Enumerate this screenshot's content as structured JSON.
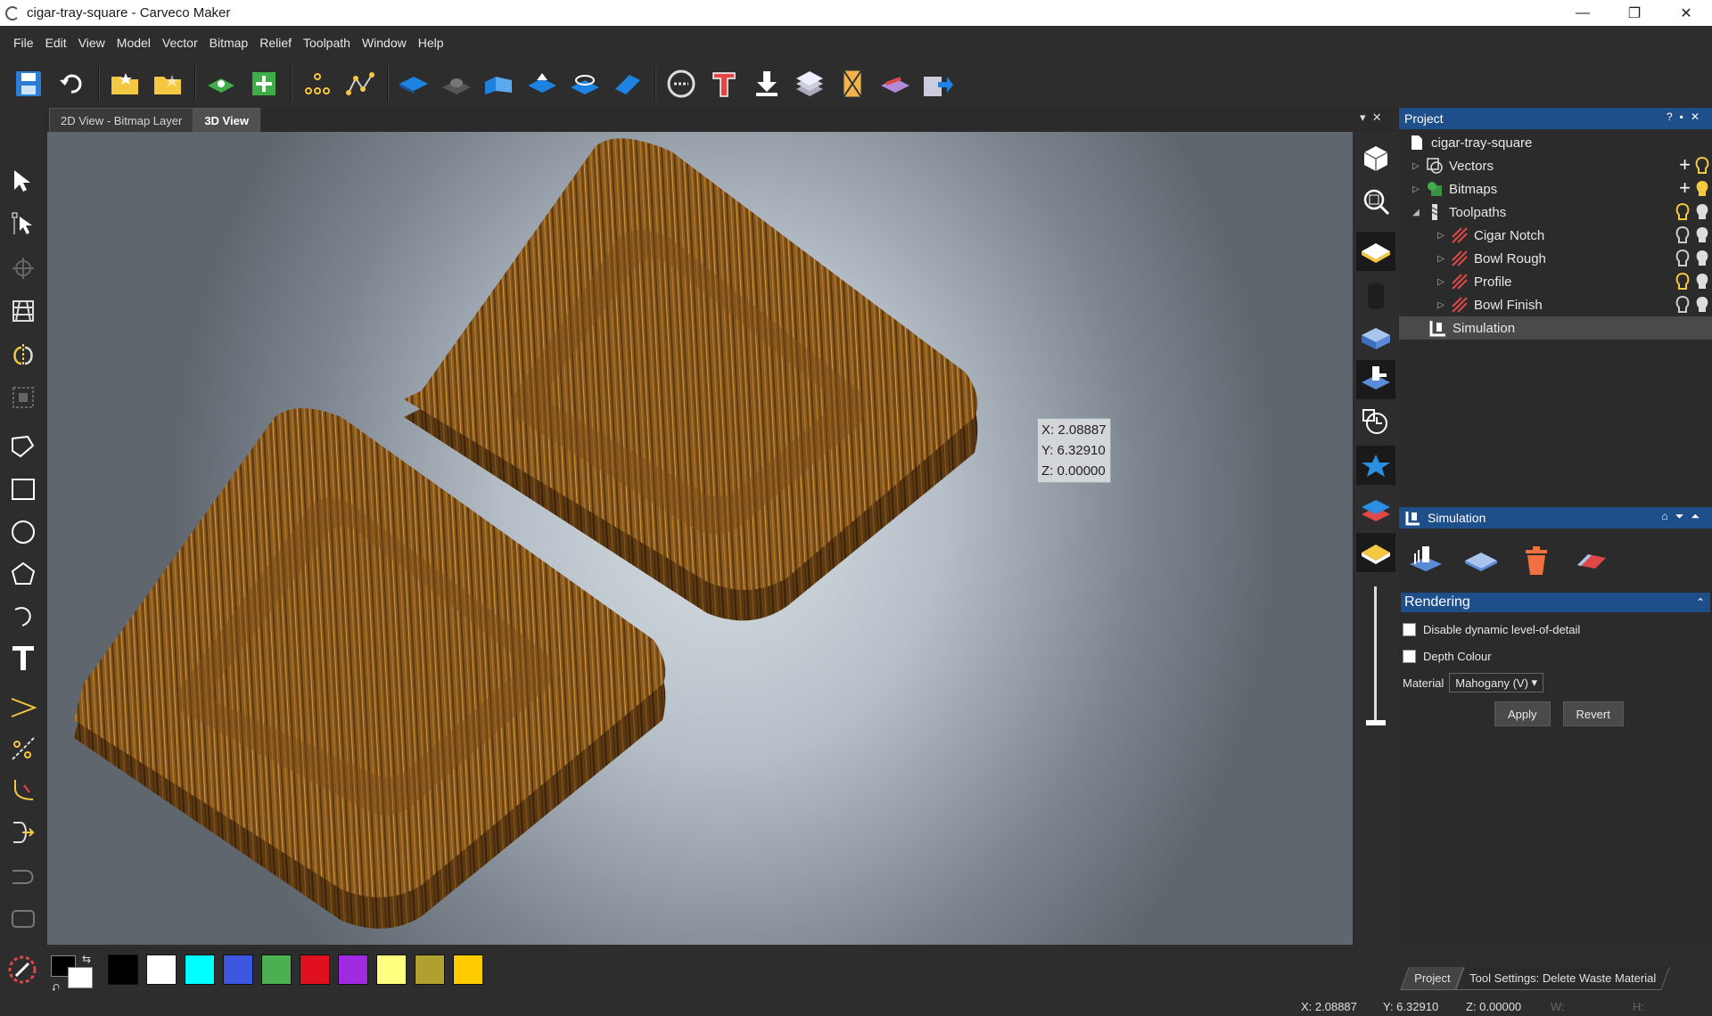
{
  "window": {
    "title": "cigar-tray-square - Carveco Maker",
    "minimize": "—",
    "restore": "❐",
    "close": "✕"
  },
  "menu": [
    "File",
    "Edit",
    "View",
    "Model",
    "Vector",
    "Bitmap",
    "Relief",
    "Toolpath",
    "Window",
    "Help"
  ],
  "toolbar": {
    "icons": [
      "save-icon",
      "undo-icon",
      "open-folder-icon",
      "open-recent-icon",
      "add-relief-icon",
      "new-layer-icon",
      "nodes-icon",
      "polyline-icon",
      "flat-relief-icon",
      "dome-relief-icon",
      "extrude-icon",
      "sweep-icon",
      "spin-icon",
      "angled-plane-icon",
      "smooth-icon",
      "text-tool-icon",
      "import-icon",
      "layer-stack-icon",
      "tile-icon",
      "relief-3d-icon",
      "export-icon"
    ]
  },
  "tabs": {
    "bitmap": "2D View - Bitmap Layer",
    "view3d": "3D View"
  },
  "view3d": {
    "overlay": {
      "x": "X: 2.08887",
      "y": "Y: 6.32910",
      "z": "Z: 0.00000"
    },
    "material_color": "#8a5a1e"
  },
  "project": {
    "title": "Project",
    "root": "cigar-tray-square",
    "vectors": "Vectors",
    "bitmaps": "Bitmaps",
    "toolpaths": "Toolpaths",
    "toolpath_items": [
      "Cigar Notch",
      "Bowl Rough",
      "Profile",
      "Bowl Finish"
    ],
    "simulation": "Simulation"
  },
  "sim_panel": {
    "title": "Simulation",
    "rendering_header": "Rendering",
    "disable_lod": "Disable dynamic level-of-detail",
    "depth_colour": "Depth Colour",
    "material_label": "Material",
    "material_value": "Mahogany (V)",
    "apply": "Apply",
    "revert": "Revert"
  },
  "swatches": [
    "#000000",
    "#ffffff",
    "#00ffff",
    "#3c56e0",
    "#4caf50",
    "#e0101e",
    "#a02ae0",
    "#ffff80",
    "#b0a030",
    "#ffcc00"
  ],
  "bottom_tabs": {
    "project": "Project",
    "tool_settings": "Tool Settings: Delete Waste Material"
  },
  "status": {
    "x": "X: 2.08887",
    "y": "Y: 6.32910",
    "z": "Z: 0.00000",
    "w": "W:",
    "h": "H:"
  }
}
